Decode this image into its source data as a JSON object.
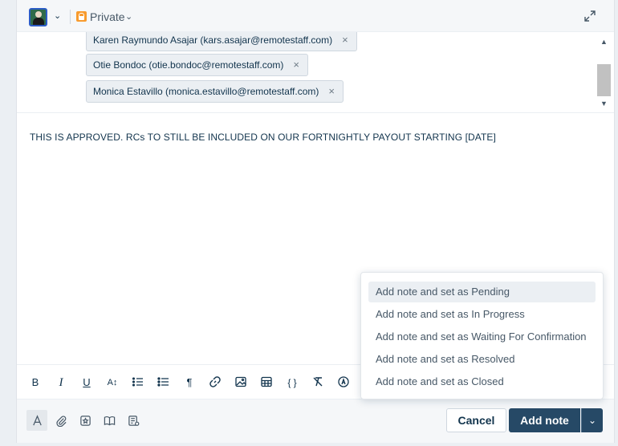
{
  "header": {
    "visibility_label": "Private",
    "avatar_icon": "user-avatar-icon",
    "expand_icon": "expand-icon"
  },
  "recipients": [
    {
      "text": "Karen Raymundo Asajar (kars.asajar@remotestaff.com)"
    },
    {
      "text": "Otie Bondoc (otie.bondoc@remotestaff.com)"
    },
    {
      "text": "Monica Estavillo (monica.estavillo@remotestaff.com)"
    }
  ],
  "remove_glyph": "×",
  "note": {
    "body": "THIS IS APPROVED. RCs TO STILL BE INCLUDED ON OUR FORTNIGHTLY PAYOUT STARTING [DATE]"
  },
  "format_toolbar": {
    "bold": "B",
    "italic": "I",
    "underline": "U",
    "font_size": "A↕",
    "paragraph": "¶",
    "code": "{ }"
  },
  "footer": {
    "cancel_label": "Cancel",
    "add_note_label": "Add note"
  },
  "menu": {
    "items": [
      "Add note and set as Pending",
      "Add note and set as In Progress",
      "Add note and set as Waiting For Confirmation",
      "Add note and set as Resolved",
      "Add note and set as Closed"
    ]
  },
  "colors": {
    "primary_button": "#264966",
    "lock_accent": "#f89b2e",
    "text": "#12344d"
  }
}
